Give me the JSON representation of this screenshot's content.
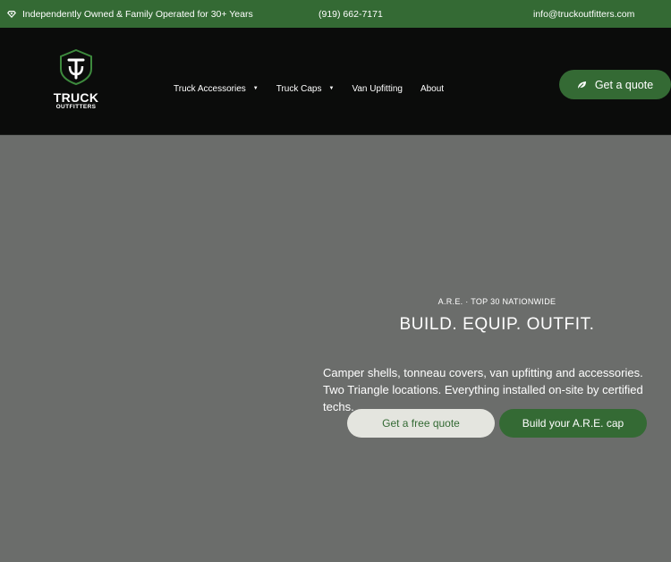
{
  "topbar": {
    "tagline": "Independently Owned & Family Operated for 30+ Years",
    "tagline_icon": "diamond-icon",
    "phone": "(919) 662-7171",
    "email": "info@truckoutfitters.com"
  },
  "header": {
    "logo": {
      "line1": "TRUCK",
      "line2": "OUTFITTERS"
    },
    "nav": [
      {
        "label": "Truck Accessories",
        "has_dropdown": true
      },
      {
        "label": "Truck Caps",
        "has_dropdown": true
      },
      {
        "label": "Van Upfitting",
        "has_dropdown": false
      },
      {
        "label": "About",
        "has_dropdown": false
      }
    ],
    "cta": {
      "label": "Get a quote",
      "icon": "leaf-icon"
    }
  },
  "hero": {
    "eyebrow": "A.R.E. · TOP 30 NATIONWIDE",
    "headline": "BUILD. EQUIP. OUTFIT.",
    "description": "Camper shells, tonneau covers, van upfitting and accessories. Two Triangle locations. Everything installed on-site by certified techs.",
    "primary_button": "Get a free quote",
    "secondary_button": "Build your A.R.E. cap"
  },
  "colors": {
    "brand_green": "#346a34",
    "header_bg": "#0b0c0b",
    "hero_bg": "#6b6d6b",
    "light_button": "#e4e5df"
  }
}
